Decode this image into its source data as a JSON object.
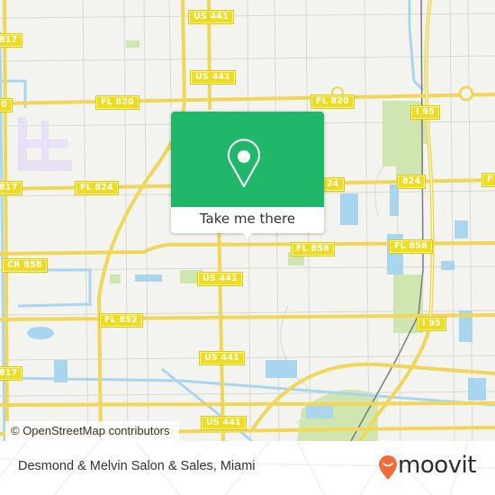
{
  "map": {
    "colors": {
      "land": "#f3f3ef",
      "road_major": "#f7e05e",
      "road_minor": "#d6d6d0",
      "water": "#a9d6ee",
      "park": "#cfe6b0",
      "airport": "#e8e0f5",
      "rail": "#7c7c7c",
      "popup_accent": "#21b76a"
    },
    "shields": [
      {
        "label": "US 441"
      },
      {
        "label": "US 441"
      },
      {
        "label": "817"
      },
      {
        "label": "0"
      },
      {
        "label": "FL 820"
      },
      {
        "label": "FL 820"
      },
      {
        "label": "I 95"
      },
      {
        "label": "817"
      },
      {
        "label": "FL 824"
      },
      {
        "label": "24"
      },
      {
        "label": "824"
      },
      {
        "label": "F"
      },
      {
        "label": "CR 858"
      },
      {
        "label": "FL 858"
      },
      {
        "label": "FL 858"
      },
      {
        "label": "US 441"
      },
      {
        "label": "FL 852"
      },
      {
        "label": "I 95"
      },
      {
        "label": "US 441"
      },
      {
        "label": "817"
      },
      {
        "label": "US 441"
      }
    ],
    "attribution": "© OpenStreetMap contributors"
  },
  "popup": {
    "icon": "map-pin-icon",
    "button_label": "Take me there"
  },
  "footer": {
    "place_name": "Desmond & Melvin Salon & Sales, Miami",
    "brand_icon": "moovit-pin-icon",
    "brand_name": "moovit",
    "brand_color": "#f26b3a"
  }
}
